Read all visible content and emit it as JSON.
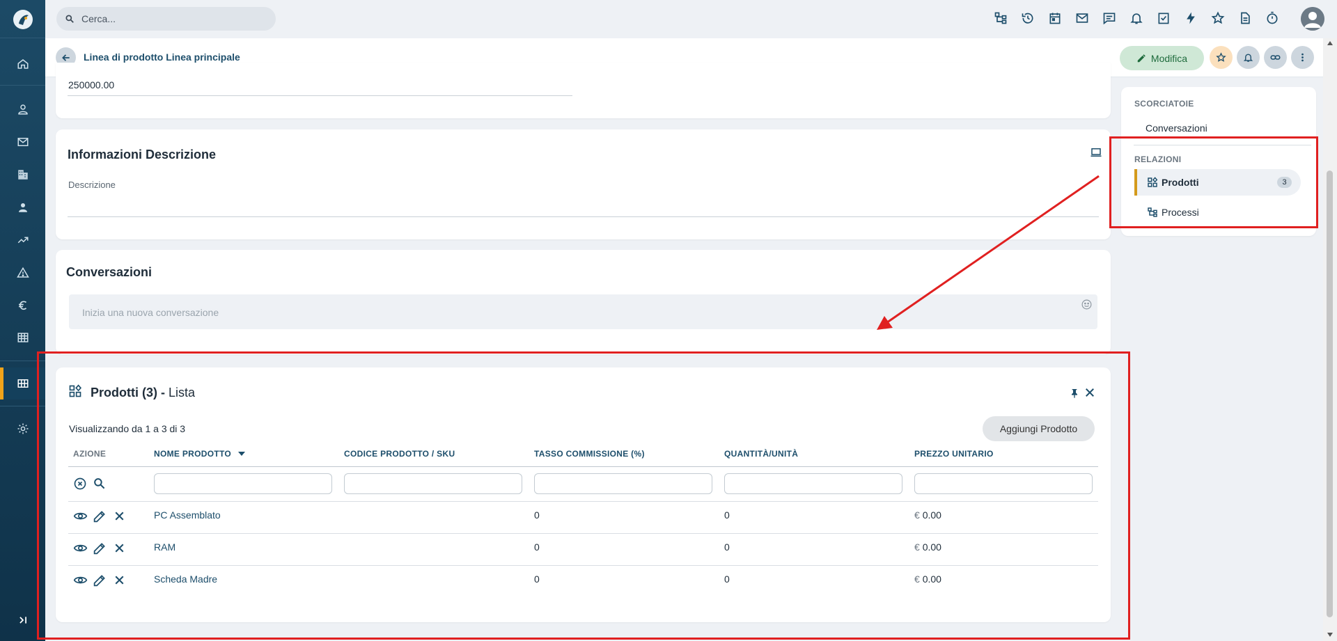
{
  "search": {
    "placeholder": "Cerca..."
  },
  "sidebar": {
    "items": [
      {
        "name": "home-icon"
      },
      {
        "name": "user-icon"
      },
      {
        "name": "mail-icon"
      },
      {
        "name": "building-icon"
      },
      {
        "name": "person-icon"
      },
      {
        "name": "trending-icon"
      },
      {
        "name": "warning-icon"
      },
      {
        "name": "euro-icon"
      },
      {
        "name": "table-icon"
      },
      {
        "name": "grid-icon",
        "active": true
      },
      {
        "name": "gear-icon"
      }
    ],
    "expand_icon": "expand-icon"
  },
  "topbar": {
    "icons": [
      "hierarchy-icon",
      "history-icon",
      "calendar-icon",
      "mail-icon",
      "chat-icon",
      "bell-icon",
      "task-icon",
      "bolt-icon",
      "star-icon",
      "document-icon",
      "timer-icon"
    ]
  },
  "header": {
    "title": "Linea di prodotto Linea principale",
    "edit_label": "Modifica"
  },
  "top_card": {
    "value": "250000.00"
  },
  "description": {
    "title": "Informazioni Descrizione",
    "label": "Descrizione"
  },
  "conversations": {
    "title": "Conversazioni",
    "placeholder": "Inizia una nuova conversazione"
  },
  "products": {
    "title_bold": "Prodotti (3) -",
    "title_rest": "Lista",
    "showing": "Visualizzando da 1 a 3 di 3",
    "add_label": "Aggiungi Prodotto",
    "columns": [
      "AZIONE",
      "NOME PRODOTTO",
      "CODICE PRODOTTO / SKU",
      "TASSO COMMISSIONE (%)",
      "QUANTITÀ/UNITÀ",
      "PREZZO UNITARIO"
    ],
    "rows": [
      {
        "name": "PC Assemblato",
        "sku": "",
        "commission": "0",
        "quantity": "0",
        "currency": "€",
        "price": "0.00"
      },
      {
        "name": "RAM",
        "sku": "",
        "commission": "0",
        "quantity": "0",
        "currency": "€",
        "price": "0.00"
      },
      {
        "name": "Scheda Madre",
        "sku": "",
        "commission": "0",
        "quantity": "0",
        "currency": "€",
        "price": "0.00"
      }
    ]
  },
  "side": {
    "shortcuts_title": "SCORCIATOIE",
    "shortcuts": [
      "Conversazioni"
    ],
    "relations_title": "RELAZIONI",
    "relations": [
      {
        "label": "Prodotti",
        "count": "3",
        "active": true
      },
      {
        "label": "Processi"
      }
    ]
  },
  "colors": {
    "sidebar": "#1c4a66",
    "accent": "#d49a1c",
    "link": "#1d4e6b",
    "annotation": "#e02020",
    "edit_button": "#cfe8d6"
  }
}
